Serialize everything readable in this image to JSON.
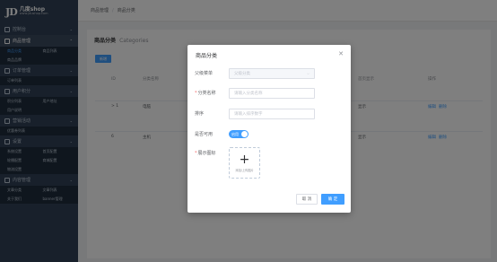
{
  "logo": {
    "mark": "JD",
    "name": "几度shop",
    "url": "www.jdushop.com"
  },
  "sidebar": {
    "groups": [
      {
        "label": "控制台",
        "active": false,
        "subs": []
      },
      {
        "label": "商品管理",
        "active": true,
        "subs": [
          [
            "商品分类",
            "商品列表"
          ],
          [
            "商品品牌"
          ]
        ]
      },
      {
        "label": "订单管理",
        "active": false,
        "subs": [
          [
            "订单列表"
          ]
        ]
      },
      {
        "label": "用户积分",
        "active": false,
        "subs": [
          [
            "积分列表",
            "用户地址"
          ],
          [
            "用户说明"
          ]
        ]
      },
      {
        "label": "营销活动",
        "active": false,
        "subs": [
          [
            "优惠券列表"
          ]
        ]
      },
      {
        "label": "设置",
        "active": false,
        "subs": [
          [
            "系统设置",
            "首页配置"
          ],
          [
            "轮播配置",
            "商城配置"
          ],
          [
            "物流设置"
          ]
        ]
      },
      {
        "label": "内容管理",
        "active": false,
        "subs": [
          [
            "文章分类",
            "文章列表"
          ],
          [
            "关于我们",
            "banner管理"
          ]
        ]
      }
    ]
  },
  "breadcrumb": {
    "root": "商品管理",
    "sep": "/",
    "current": "商品分类"
  },
  "card": {
    "title": "商品分类",
    "title_en": "Categories",
    "add_label": "新增"
  },
  "table": {
    "headers": {
      "id": "ID",
      "name": "分类名称",
      "show": "首页显示",
      "op": "操作"
    },
    "rows": [
      {
        "id": "> 1",
        "name": "电脑",
        "show": "显示"
      },
      {
        "id": "6",
        "name": "主机",
        "show": "显示"
      }
    ],
    "edit": "编辑",
    "del": "删除"
  },
  "dialog": {
    "title": "商品分类",
    "parent_label": "父级菜单",
    "parent_placeholder": "父级分类",
    "name_label": "分类名称",
    "name_placeholder": "请输入分类名称",
    "sort_label": "排序",
    "sort_placeholder": "请输入排序数字",
    "visible_label": "是否可用",
    "visible_text": "启用",
    "visible_on": true,
    "icon_label": "展示图标",
    "upload_hint": "添加/上传图片",
    "cancel": "取 消",
    "confirm": "确 定"
  }
}
